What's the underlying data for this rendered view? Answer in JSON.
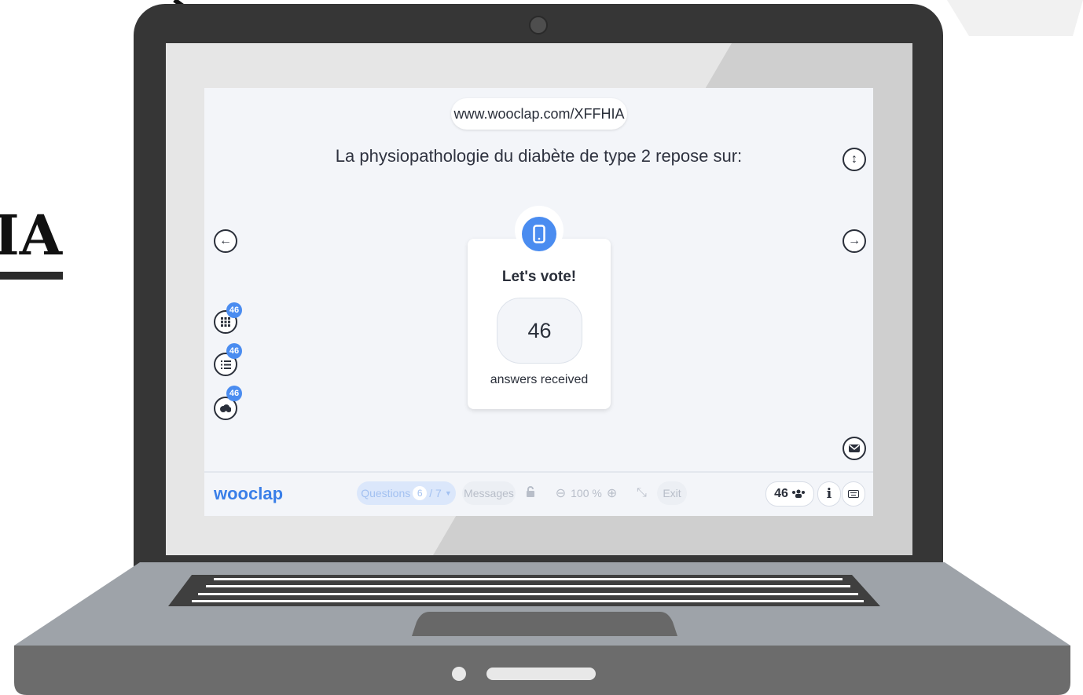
{
  "slide": {
    "partial_title": "IA"
  },
  "screen": {
    "url": "www.wooclap.com/XFFHIA",
    "question": "La physiopathologie du diabète de type 2 repose sur:",
    "vote_title": "Let's vote!",
    "answer_count": "46",
    "answers_label": "answers received",
    "side_badges": [
      "46",
      "46",
      "46"
    ]
  },
  "toolbar": {
    "logo": "wooclap",
    "questions_label": "Questions",
    "question_current": "6",
    "question_total": "/ 7",
    "messages_label": "Messages",
    "zoom": "100 %",
    "exit_label": "Exit",
    "participants": "46"
  },
  "colors": {
    "accent": "#4a8cf0",
    "text": "#2a2f3a",
    "app_bg": "#f3f5f9"
  },
  "icons": [
    "lock-icon",
    "zoom-out-icon",
    "zoom-in-icon",
    "fullscreen-icon",
    "info-icon",
    "keyboard-icon",
    "participants-icon",
    "phone-icon",
    "arrow-left-icon",
    "arrow-right-icon",
    "expand-vertical-icon",
    "mail-icon",
    "grid-icon",
    "list-icon",
    "cloud-icon"
  ]
}
